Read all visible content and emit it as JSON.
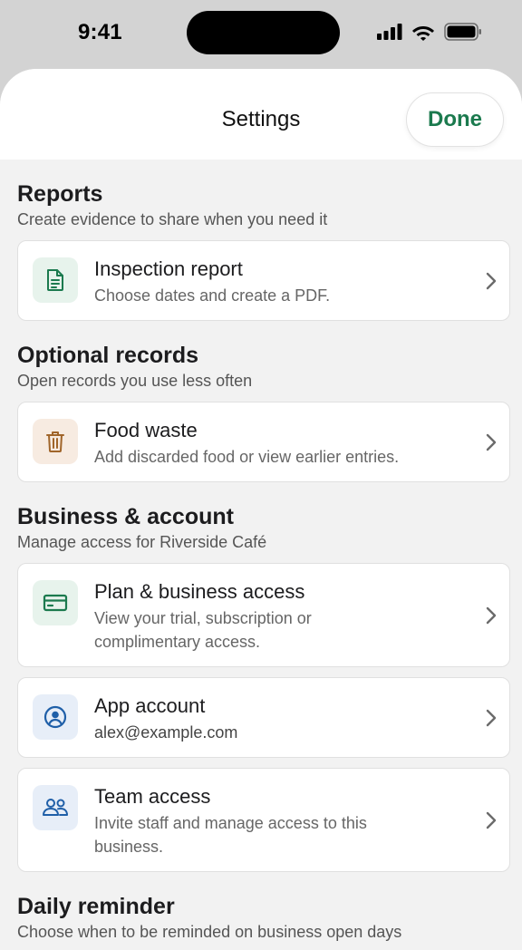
{
  "status": {
    "time": "9:41"
  },
  "header": {
    "title": "Settings",
    "done_label": "Done"
  },
  "sections": [
    {
      "title": "Reports",
      "subtitle": "Create evidence to share when you need it",
      "items": [
        {
          "title": "Inspection report",
          "description": "Choose dates and create a PDF.",
          "icon": "document-icon"
        }
      ]
    },
    {
      "title": "Optional records",
      "subtitle": "Open records you use less often",
      "items": [
        {
          "title": "Food waste",
          "description": "Add discarded food or view earlier entries.",
          "icon": "trash-icon"
        }
      ]
    },
    {
      "title": "Business & account",
      "subtitle": "Manage access for Riverside Café",
      "items": [
        {
          "title": "Plan & business access",
          "description": "View your trial, subscription or complimentary access.",
          "icon": "card-icon"
        },
        {
          "title": "App account",
          "description": "alex@example.com",
          "icon": "user-circle-icon"
        },
        {
          "title": "Team access",
          "description": "Invite staff and manage access to this business.",
          "icon": "team-icon"
        }
      ]
    },
    {
      "title": "Daily reminder",
      "subtitle": "Choose when to be reminded on business open days",
      "items": []
    }
  ],
  "colors": {
    "accent": "#1b7a4e",
    "green_icon": "#1b7a4e",
    "tan_icon": "#a0652a",
    "blue_icon": "#1f5fa8"
  }
}
